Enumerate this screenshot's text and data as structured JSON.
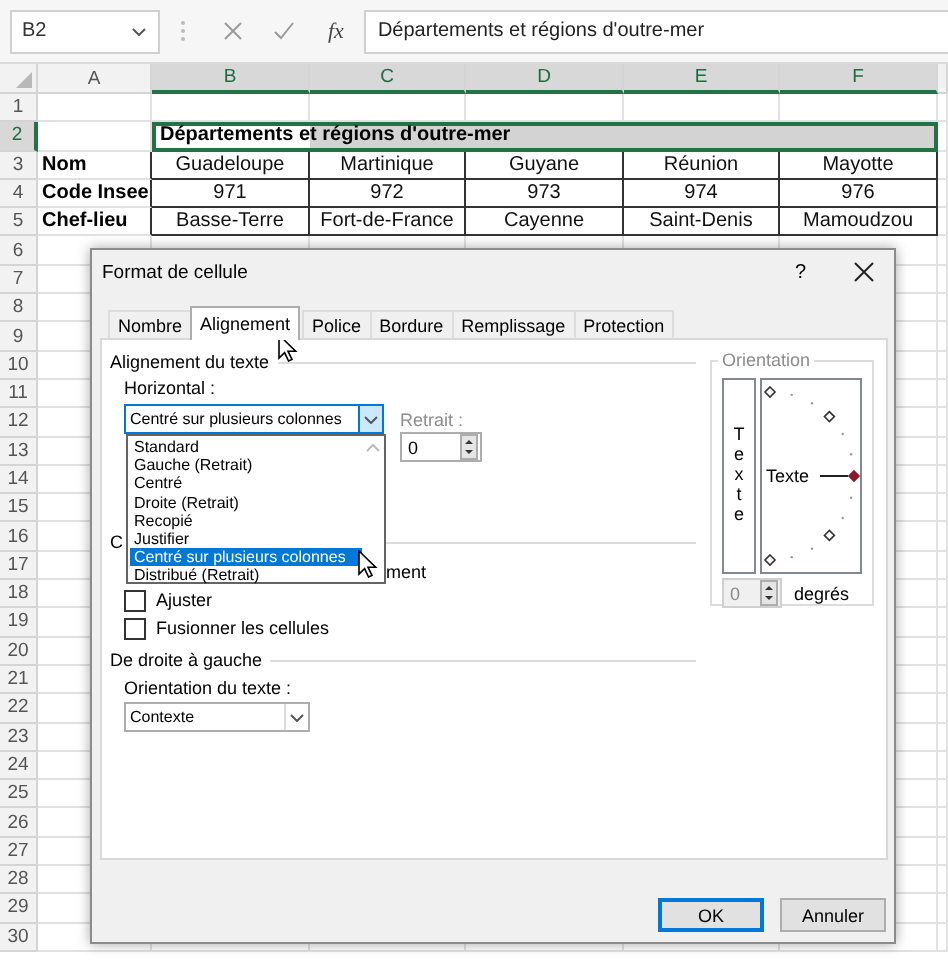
{
  "name_box": "B2",
  "function_label": "fx",
  "formula": "Départements et régions d'outre-mer",
  "columns": [
    {
      "label": "A",
      "selected": false
    },
    {
      "label": "B",
      "selected": true
    },
    {
      "label": "C",
      "selected": true
    },
    {
      "label": "D",
      "selected": true
    },
    {
      "label": "E",
      "selected": true
    },
    {
      "label": "F",
      "selected": true
    }
  ],
  "row_numbers": [
    {
      "label": "1",
      "selected": false
    },
    {
      "label": "2",
      "selected": true
    },
    {
      "label": "3",
      "selected": false
    },
    {
      "label": "4",
      "selected": false
    },
    {
      "label": "5",
      "selected": false
    },
    {
      "label": "6",
      "selected": false
    },
    {
      "label": "7",
      "selected": false
    },
    {
      "label": "8",
      "selected": false
    },
    {
      "label": "9",
      "selected": false
    },
    {
      "label": "10",
      "selected": false
    },
    {
      "label": "11",
      "selected": false
    },
    {
      "label": "12",
      "selected": false
    },
    {
      "label": "13",
      "selected": false
    },
    {
      "label": "14",
      "selected": false
    },
    {
      "label": "15",
      "selected": false
    },
    {
      "label": "16",
      "selected": false
    },
    {
      "label": "17",
      "selected": false
    },
    {
      "label": "18",
      "selected": false
    },
    {
      "label": "19",
      "selected": false
    },
    {
      "label": "20",
      "selected": false
    },
    {
      "label": "21",
      "selected": false
    },
    {
      "label": "22",
      "selected": false
    },
    {
      "label": "23",
      "selected": false
    },
    {
      "label": "24",
      "selected": false
    },
    {
      "label": "25",
      "selected": false
    },
    {
      "label": "26",
      "selected": false
    },
    {
      "label": "27",
      "selected": false
    },
    {
      "label": "28",
      "selected": false
    },
    {
      "label": "29",
      "selected": false
    },
    {
      "label": "30",
      "selected": false
    }
  ],
  "table": {
    "title": "Départements et régions d'outre-mer",
    "records": [
      {
        "label": "Nom",
        "values": [
          "Guadeloupe",
          "Martinique",
          "Guyane",
          "Réunion",
          "Mayotte"
        ]
      },
      {
        "label": "Code Insee",
        "values": [
          "971",
          "972",
          "973",
          "974",
          "976"
        ]
      },
      {
        "label": "Chef-lieu",
        "values": [
          "Basse-Terre",
          "Fort-de-France",
          "Cayenne",
          "Saint-Denis",
          "Mamoudzou"
        ]
      }
    ]
  },
  "dialog": {
    "title": "Format de cellule",
    "help": "?",
    "tabs": [
      {
        "label": "Nombre",
        "selected": false
      },
      {
        "label": "Alignement",
        "selected": true
      },
      {
        "label": "Police",
        "selected": false
      },
      {
        "label": "Bordure",
        "selected": false
      },
      {
        "label": "Remplissage",
        "selected": false
      },
      {
        "label": "Protection",
        "selected": false
      }
    ],
    "text_alignment": {
      "heading": "Alignement du texte",
      "horizontal_label": "Horizontal :",
      "horizontal_value": "Centré sur plusieurs colonnes",
      "expanded": true,
      "options": [
        {
          "label": "Standard",
          "selected": false
        },
        {
          "label": "Gauche (Retrait)",
          "selected": false
        },
        {
          "label": "Centré",
          "selected": false
        },
        {
          "label": "Droite (Retrait)",
          "selected": false
        },
        {
          "label": "Recopié",
          "selected": false
        },
        {
          "label": "Justifier",
          "selected": false
        },
        {
          "label": "Centré sur plusieurs colonnes",
          "selected": true
        },
        {
          "label": "Distribué (Retrait)",
          "selected": false
        }
      ],
      "indent": {
        "label": "Retrait :",
        "value": "0",
        "disabled": true
      }
    },
    "text_control": {
      "heading_fragment": "C",
      "wrap_fragment": "ment",
      "options": [
        {
          "label": "Ajuster",
          "checked": false
        },
        {
          "label": "Fusionner les cellules",
          "checked": false
        }
      ]
    },
    "right_to_left": {
      "heading": "De droite à gauche",
      "direction_label": "Orientation du texte :",
      "direction_value": "Contexte"
    },
    "orientation": {
      "heading": "Orientation",
      "disabled": true,
      "vertical_text": "Texte",
      "dial_text": "Texte",
      "degrees_value": "0",
      "degrees_label": "degrés"
    },
    "buttons": [
      {
        "label": "OK",
        "default": true
      },
      {
        "label": "Annuler",
        "default": false
      }
    ]
  }
}
